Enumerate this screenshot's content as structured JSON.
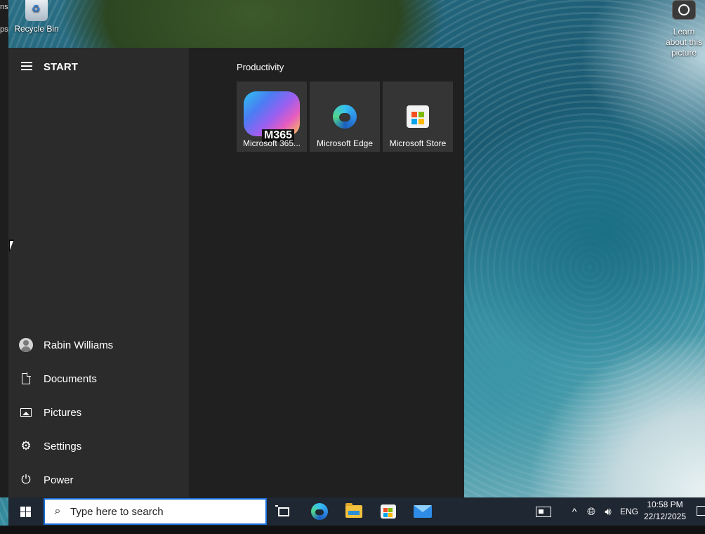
{
  "desktop": {
    "recycle_bin_label": "Recycle Bin",
    "learn_about_label": "Learn about this picture",
    "left_edge_texts": [
      "ns",
      "ps"
    ]
  },
  "start_menu": {
    "title": "START",
    "user": {
      "name": "Rabin Williams",
      "icon": "user-avatar-icon"
    },
    "nav_items": [
      {
        "label": "Documents",
        "icon": "document-icon"
      },
      {
        "label": "Pictures",
        "icon": "pictures-icon"
      },
      {
        "label": "Settings",
        "icon": "gear-icon"
      },
      {
        "label": "Power",
        "icon": "power-icon"
      }
    ],
    "group_label": "Productivity",
    "tiles": [
      {
        "label": "Microsoft 365...",
        "badge": "M365",
        "icon": "microsoft-365-icon"
      },
      {
        "label": "Microsoft Edge",
        "icon": "edge-icon"
      },
      {
        "label": "Microsoft Store",
        "icon": "store-icon"
      }
    ]
  },
  "taskbar": {
    "search_placeholder": "Type here to search",
    "apps": [
      "task-view-icon",
      "edge-icon",
      "file-explorer-icon",
      "store-icon",
      "mail-icon"
    ],
    "tray": {
      "language": "ENG",
      "time": "10:58 PM",
      "date": "22/12/2025"
    }
  },
  "colors": {
    "start_bg": "#202020",
    "start_left_bg": "#2b2b2b",
    "tile_bg": "#353535",
    "taskbar_bg": "#1f2733",
    "search_border": "#1a6ed8"
  }
}
